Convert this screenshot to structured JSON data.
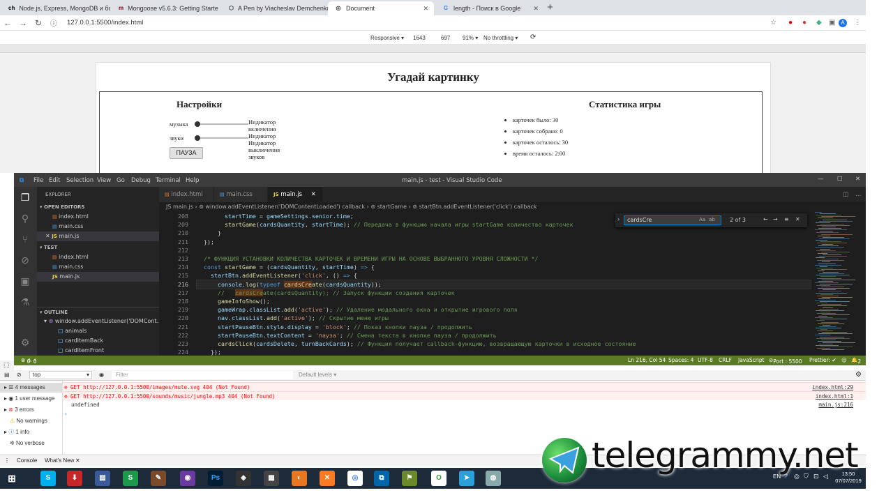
{
  "browser": {
    "tabs": [
      {
        "icon": "ch",
        "title": "Node.js, Express, MongoDB и бо"
      },
      {
        "icon": "m",
        "title": "Mongoose v5.6.3: Getting Starte"
      },
      {
        "icon": "codepen",
        "title": "A Pen by Viacheslav Demchenko"
      },
      {
        "icon": "globe",
        "title": "Document"
      },
      {
        "icon": "google",
        "title": "length - Поиск в Google"
      }
    ],
    "active_tab": 3,
    "url": "127.0.0.1:5500/index.html",
    "device_toolbar": {
      "mode": "Responsive ▾",
      "width": "1643",
      "height": "697",
      "zoom": "91% ▾",
      "throttle": "No throttling ▾"
    }
  },
  "page": {
    "title": "Угадай картинку",
    "settings_title": "Настройки",
    "music_label": "музыка",
    "sound_label": "звуки",
    "music_img_alt": "Индикатор включения музыки",
    "sound_img_alt": "Индикатор выключения звуков",
    "sound_img_alt2": "Индикатор выключения музыки",
    "pause_button": "ПАУЗА",
    "stats_title": "Статистика игры",
    "stats": [
      "карточек было: 30",
      "карточек собрано: 0",
      "карточек осталось: 30",
      "время осталось: 2:00"
    ]
  },
  "vscode": {
    "menu": [
      "File",
      "Edit",
      "Selection",
      "View",
      "Go",
      "Debug",
      "Terminal",
      "Help"
    ],
    "window_title": "main.js - test - Visual Studio Code",
    "explorer_title": "EXPLORER",
    "open_editors_title": "OPEN EDITORS",
    "open_editors": [
      {
        "type": "html",
        "name": "index.html"
      },
      {
        "type": "css",
        "name": "main.css"
      },
      {
        "type": "js",
        "name": "main.js"
      }
    ],
    "folder_title": "TEST",
    "folder_files": [
      {
        "type": "html",
        "name": "index.html"
      },
      {
        "type": "css",
        "name": "main.css"
      },
      {
        "type": "js",
        "name": "main.js"
      }
    ],
    "outline_title": "OUTLINE",
    "outline": [
      "window.addEventListener('DOMCont...",
      "animals",
      "cardItemBack",
      "cardItemFront"
    ],
    "tabs": [
      {
        "type": "html",
        "name": "index.html"
      },
      {
        "type": "css",
        "name": "main.css"
      },
      {
        "type": "js",
        "name": "main.js"
      }
    ],
    "breadcrumb": "JS main.js › ⊚ window.addEventListener('DOMContentLoaded') callback › ⊚ startGame › ⊚ startBtn.addEventListener('click') callback",
    "find_query": "cardsCre",
    "find_result": "2 of 3",
    "line_numbers": [
      "208",
      "209",
      "210",
      "211",
      "212",
      "213",
      "214",
      "215",
      "216",
      "217",
      "218",
      "219",
      "220",
      "221",
      "222",
      "223",
      "224"
    ],
    "current_line": "216",
    "status": {
      "errors": "0",
      "warnings": "0",
      "position": "Ln 216, Col 54",
      "spaces": "Spaces: 4",
      "encoding": "UTF-8",
      "eol": "CRLF",
      "language": "JavaScript",
      "port": "Port : 5500",
      "prettier": "Prettier: ✔",
      "bell": "2"
    }
  },
  "console": {
    "context": "top",
    "filter_placeholder": "Filter",
    "levels": "Default levels ▾",
    "sidebar": [
      "4 messages",
      "1 user message",
      "3 errors",
      "No warnings",
      "1 info",
      "No verbose"
    ],
    "messages": [
      {
        "kind": "error",
        "text": "GET http://127.0.0.1:5500/images/mute.svg 404 (Not Found)",
        "source": "index.html:29"
      },
      {
        "kind": "error",
        "text": "GET http://127.0.0.1:5500/sounds/music/jungle.mp3 404 (Not Found)",
        "source": "index.html:1"
      },
      {
        "kind": "log",
        "text": "undefined",
        "source": "main.js:216"
      }
    ],
    "prompt": "›",
    "drawer_tabs": [
      "Console",
      "What's New"
    ]
  },
  "taskbar": {
    "lang": "EN",
    "time": "13:50",
    "date": "07/07/2019"
  },
  "watermark": "telegrammy.net"
}
